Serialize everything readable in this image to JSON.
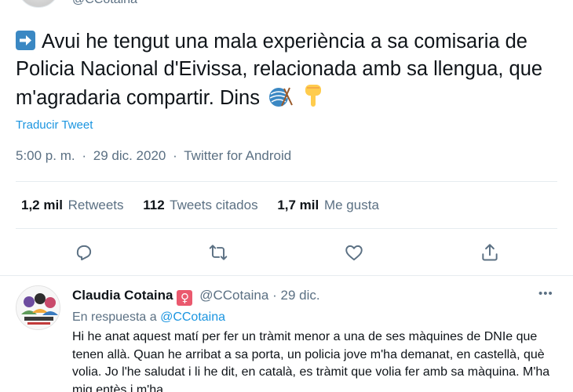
{
  "top": {
    "handle": "@CCotaina"
  },
  "tweet": {
    "text": "Avui he tengut una mala experiència a sa comisaria de Policia Nacional d'Eivissa, relacionada amb sa llengua, que m'agradaria compartir. Dins",
    "emoji_icons": [
      "arrow-right-emoji",
      "yarn-emoji",
      "pointing-down-emoji"
    ],
    "translate_label": "Traducir Tweet",
    "time": "5:00 p. m.",
    "date": "29 dic. 2020",
    "source": "Twitter for Android",
    "separator": "·"
  },
  "stats": {
    "retweets_count": "1,2 mil",
    "retweets_label": "Retweets",
    "quotes_count": "112",
    "quotes_label": "Tweets citados",
    "likes_count": "1,7 mil",
    "likes_label": "Me gusta"
  },
  "actions": [
    "reply-icon",
    "retweet-icon",
    "like-icon",
    "share-icon"
  ],
  "reply": {
    "name": "Claudia Cotaina",
    "badge": "♀",
    "handle": "@CCotaina",
    "separator": "·",
    "date": "29 dic.",
    "more": "•••",
    "in_reply_prefix": "En respuesta a",
    "in_reply_handle": "@CCotaina",
    "body": "Hi he anat aquest matí per fer un tràmit menor a una de ses màquines de DNIe que tenen allà. Quan he arribat a sa porta, un policia jove m'ha demanat, en castellà, què volia. Jo l'he saludat i li he dit, en català, es tràmit que volia fer amb sa màquina. M'ha mig entès i m'ha..."
  },
  "colors": {
    "link": "#1b95e0",
    "secondary": "#5b7083",
    "divider": "#e6ecf0",
    "badge": "#ea596e"
  }
}
